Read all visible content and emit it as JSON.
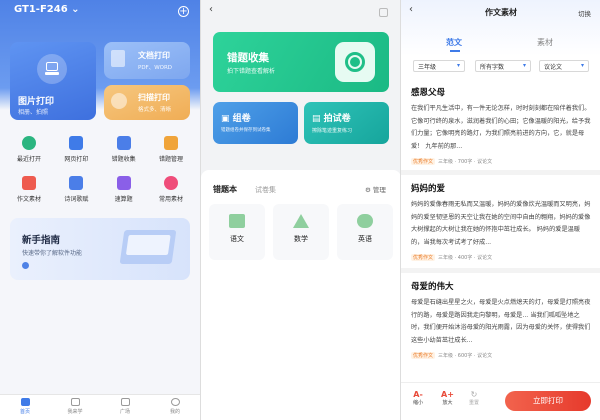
{
  "panel1": {
    "device": "GT1-F246",
    "photo_print": {
      "title": "图片打印",
      "sub": "相册、拍照"
    },
    "doc_print": {
      "title": "文档打印",
      "sub": "PDF、WORD"
    },
    "scan_print": {
      "title": "扫描打印",
      "sub": "格式多、清晰"
    },
    "row1": [
      "最近打开",
      "网页打印",
      "错题收集",
      "错题管理"
    ],
    "row2": [
      "作文素材",
      "诗词歌赋",
      "速算题",
      "常用素材"
    ],
    "guide": {
      "title": "新手指南",
      "sub": "快速带你了解软件功能"
    },
    "tabs": [
      "首页",
      "我来学",
      "广场",
      "我的"
    ]
  },
  "panel2": {
    "banner": {
      "title": "错题收集",
      "sub": "拍下错题查看解析"
    },
    "group": {
      "title": "组卷",
      "sub": "错题组卷并保存到试卷集"
    },
    "photo": {
      "title": "拍试卷",
      "sub": "擦除笔迹重复练习"
    },
    "tab_active": "错题本",
    "tab_inactive": "试卷集",
    "manage": "管理",
    "subjects": [
      "语文",
      "数学",
      "英语"
    ]
  },
  "panel3": {
    "title": "作文素材",
    "switch": "切换",
    "seg": [
      "范文",
      "素材"
    ],
    "filters": [
      "三年级",
      "所有字数",
      "议论文"
    ],
    "essays": [
      {
        "title": "感恩父母",
        "body": "在我们平凡生活中，有一件无论怎样，时时刻刻都在陪伴着我们。它像可行终的泉水，滋润着我们的心田；它像温暖的阳光，给予我们力量；它像明亮的路灯，为我们照亮前进的方向，它，就是母爱！ 九年前的那...",
        "tag": "优秀作文",
        "meta": "三年级 · 700字 · 议论文"
      },
      {
        "title": "妈妈的爱",
        "body": "妈妈的爱像春雨无私而又温暖，妈妈的爱像炊光温暖而又明亮，妈妈的爱坚韧坚恩的天空让我在她的空间中自由的翱翔，妈妈的爱像大树撑起的大树让我在她的怀抱中茁壮成长。 妈妈的爱是温暖的，当我每次考试考了好成...",
        "tag": "优秀作文",
        "meta": "三年级 · 400字 · 议论文"
      },
      {
        "title": "母爱的伟大",
        "body": "母爱是石缝出星星之火，母爱是火点燃熄天的灯，母爱是灯照亮夜行的路，母爱是路因我走向黎明，母爱是... 当我们呱呱坠地之时，我们便开始沐浴母爱的阳光雨露，因为母爱的关怀，使得我们这些小幼苗茁壮成长...",
        "tag": "优秀作文",
        "meta": "三年级 · 600字 · 议论文"
      }
    ],
    "tools": [
      "缩小",
      "放大",
      "重置"
    ],
    "print_button": "立即打印"
  }
}
